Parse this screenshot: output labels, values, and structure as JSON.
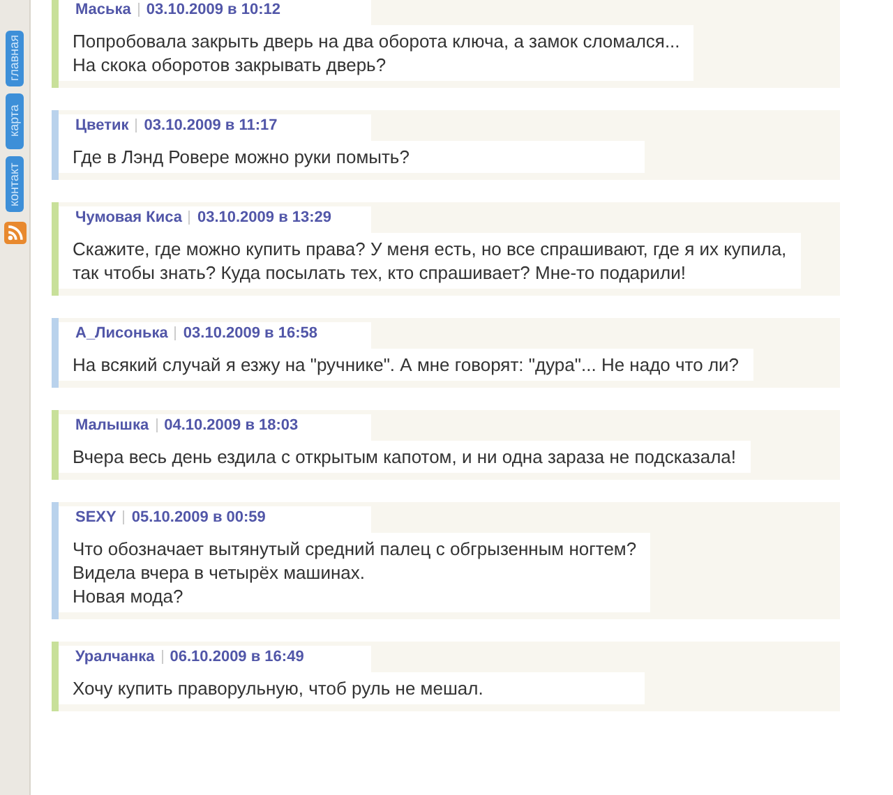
{
  "sidebar": {
    "tabs": [
      "главная",
      "карта",
      "контакт"
    ]
  },
  "comments": [
    {
      "author": "Маська",
      "date": "03.10.2009 в 10:12",
      "color": "#c8e09a",
      "lines": [
        "Попробовала закрыть дверь на два оборота ключа, а замок сломался...",
        "На скока оборотов закрывать дверь?"
      ]
    },
    {
      "author": "Цветик",
      "date": "03.10.2009 в 11:17",
      "color": "#b9d2ec",
      "lines": [
        "Где в Лэнд Ровере можно руки помыть?"
      ]
    },
    {
      "author": "Чумовая Киса",
      "date": "03.10.2009 в 13:29",
      "color": "#c8e09a",
      "lines": [
        "Скажите, где можно купить права? У меня есть, но все спрашивают, где я их купила,",
        "так чтобы знать? Куда посылать тех, кто спрашивает? Мне-то подарили!"
      ]
    },
    {
      "author": "А_Лисонька",
      "date": "03.10.2009 в 16:58",
      "color": "#b9d2ec",
      "lines": [
        "На всякий случай я езжу на \"ручнике\". А мне говорят: \"дура\"... Не надо что ли?"
      ]
    },
    {
      "author": "Малышка",
      "date": "04.10.2009 в 18:03",
      "color": "#c8e09a",
      "lines": [
        "Вчера весь день ездила с открытым капотом, и ни одна зараза не подсказала!"
      ]
    },
    {
      "author": "SEXY",
      "date": "05.10.2009 в 00:59",
      "color": "#b9d2ec",
      "lines": [
        "Что обозначает вытянутый средний палец с обгрызенным ногтем?",
        "Видела вчера в четырёх машинах.",
        "Новая мода?"
      ]
    },
    {
      "author": "Уралчанка",
      "date": "06.10.2009 в 16:49",
      "color": "#c8e09a",
      "lines": [
        "Хочу купить праворульную, чтоб руль не мешал."
      ]
    }
  ]
}
